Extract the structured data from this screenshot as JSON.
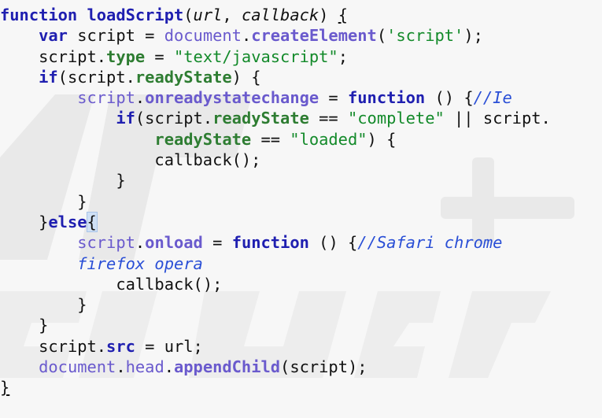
{
  "code_lines": [
    {
      "indent": "",
      "tokens": [
        {
          "t": "function",
          "c": "kw"
        },
        {
          "t": " ",
          "c": "plain"
        },
        {
          "t": "loadScript",
          "c": "fn"
        },
        {
          "t": "(",
          "c": "plain"
        },
        {
          "t": "url",
          "c": "plain ital"
        },
        {
          "t": ", ",
          "c": "plain"
        },
        {
          "t": "callback",
          "c": "plain ital"
        },
        {
          "t": ") ",
          "c": "plain"
        },
        {
          "t": "{",
          "c": "plain under"
        }
      ]
    },
    {
      "indent": "    ",
      "tokens": [
        {
          "t": "var",
          "c": "kw"
        },
        {
          "t": " script = ",
          "c": "plain"
        },
        {
          "t": "document",
          "c": "obj"
        },
        {
          "t": ".",
          "c": "plain"
        },
        {
          "t": "createElement",
          "c": "obj-b"
        },
        {
          "t": "(",
          "c": "plain"
        },
        {
          "t": "'script'",
          "c": "str"
        },
        {
          "t": ");",
          "c": "plain"
        }
      ]
    },
    {
      "indent": "    ",
      "tokens": [
        {
          "t": "script.",
          "c": "plain"
        },
        {
          "t": "type",
          "c": "prop"
        },
        {
          "t": " = ",
          "c": "plain"
        },
        {
          "t": "\"text/javascript\"",
          "c": "str"
        },
        {
          "t": ";",
          "c": "plain"
        }
      ]
    },
    {
      "indent": "    ",
      "tokens": [
        {
          "t": "if",
          "c": "kw"
        },
        {
          "t": "(script.",
          "c": "plain"
        },
        {
          "t": "readyState",
          "c": "prop"
        },
        {
          "t": ") {",
          "c": "plain"
        }
      ]
    },
    {
      "indent": "        ",
      "tokens": [
        {
          "t": "script",
          "c": "obj"
        },
        {
          "t": ".",
          "c": "plain"
        },
        {
          "t": "onreadystatechange",
          "c": "obj-b"
        },
        {
          "t": " = ",
          "c": "plain"
        },
        {
          "t": "function",
          "c": "kw"
        },
        {
          "t": " () {",
          "c": "plain"
        },
        {
          "t": "//Ie",
          "c": "cmt"
        }
      ]
    },
    {
      "indent": "            ",
      "tokens": [
        {
          "t": "if",
          "c": "kw"
        },
        {
          "t": "(script.",
          "c": "plain"
        },
        {
          "t": "readyState",
          "c": "prop"
        },
        {
          "t": " == ",
          "c": "plain"
        },
        {
          "t": "\"complete\"",
          "c": "str"
        },
        {
          "t": " || script.",
          "c": "plain"
        }
      ]
    },
    {
      "indent": "                ",
      "tokens": [
        {
          "t": "readyState",
          "c": "prop"
        },
        {
          "t": " == ",
          "c": "plain"
        },
        {
          "t": "\"loaded\"",
          "c": "str"
        },
        {
          "t": ") {",
          "c": "plain"
        }
      ]
    },
    {
      "indent": "                ",
      "tokens": [
        {
          "t": "callback();",
          "c": "plain"
        }
      ]
    },
    {
      "indent": "            ",
      "tokens": [
        {
          "t": "}",
          "c": "plain"
        }
      ]
    },
    {
      "indent": "        ",
      "tokens": [
        {
          "t": "}",
          "c": "plain"
        }
      ]
    },
    {
      "indent": "    ",
      "tokens": [
        {
          "t": "}",
          "c": "plain"
        },
        {
          "t": "else",
          "c": "kw"
        },
        {
          "t": "{",
          "c": "plain sel"
        }
      ]
    },
    {
      "indent": "        ",
      "tokens": [
        {
          "t": "script",
          "c": "obj"
        },
        {
          "t": ".",
          "c": "plain"
        },
        {
          "t": "onload",
          "c": "obj-b"
        },
        {
          "t": " = ",
          "c": "plain"
        },
        {
          "t": "function",
          "c": "kw"
        },
        {
          "t": " () {",
          "c": "plain"
        },
        {
          "t": "//Safari chrome",
          "c": "cmt"
        }
      ]
    },
    {
      "indent": "        ",
      "tokens": [
        {
          "t": "firefox opera",
          "c": "cmt"
        }
      ]
    },
    {
      "indent": "            ",
      "tokens": [
        {
          "t": "callback();",
          "c": "plain"
        }
      ]
    },
    {
      "indent": "        ",
      "tokens": [
        {
          "t": "}",
          "c": "plain"
        }
      ]
    },
    {
      "indent": "    ",
      "tokens": [
        {
          "t": "}",
          "c": "plain"
        }
      ]
    },
    {
      "indent": "    ",
      "tokens": [
        {
          "t": "script.",
          "c": "plain"
        },
        {
          "t": "src",
          "c": "prop2"
        },
        {
          "t": " = url;",
          "c": "plain"
        }
      ]
    },
    {
      "indent": "    ",
      "tokens": [
        {
          "t": "document",
          "c": "obj"
        },
        {
          "t": ".",
          "c": "plain"
        },
        {
          "t": "head",
          "c": "obj"
        },
        {
          "t": ".",
          "c": "plain"
        },
        {
          "t": "appendChild",
          "c": "obj-b"
        },
        {
          "t": "(script);",
          "c": "plain"
        }
      ]
    },
    {
      "indent": "",
      "tokens": [
        {
          "t": "}",
          "c": "plain under"
        }
      ]
    }
  ],
  "colors": {
    "background": "#f7f7f7",
    "keyword": "#1f1fb0",
    "property": "#2e7d32",
    "string": "#138a2a",
    "object": "#6a5acd",
    "comment": "#2a4fd6",
    "selection": "#cfe0f5"
  }
}
